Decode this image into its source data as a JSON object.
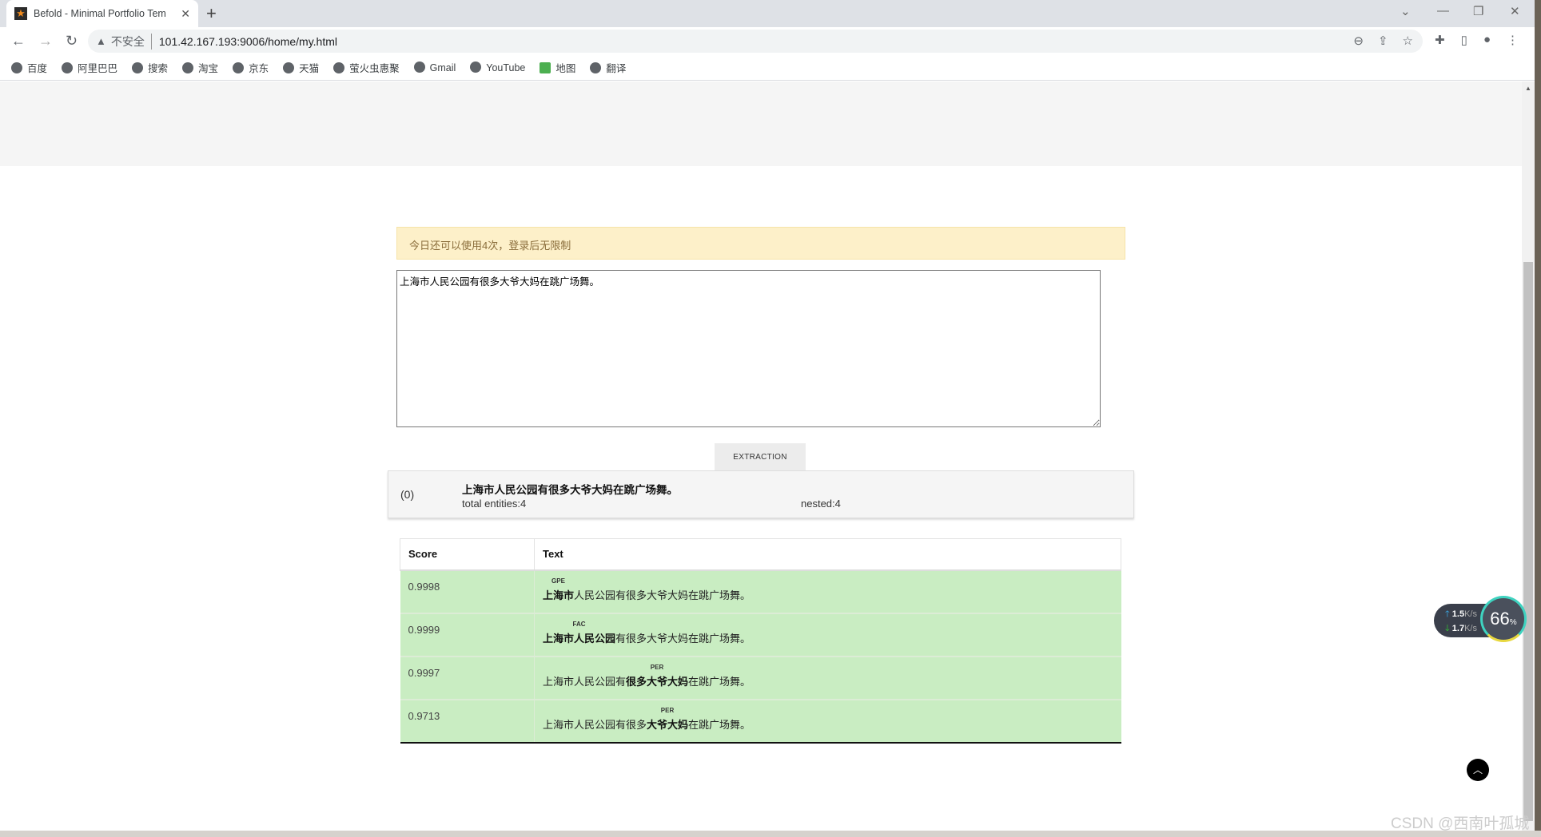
{
  "browser": {
    "tab_title": "Befold - Minimal Portfolio Tem",
    "security_label": "不安全",
    "url": "101.42.167.193:9006/home/my.html",
    "bookmarks": [
      "百度",
      "阿里巴巴",
      "搜索",
      "淘宝",
      "京东",
      "天猫",
      "萤火虫惠聚",
      "Gmail",
      "YouTube",
      "地图",
      "翻译"
    ]
  },
  "alert": "今日还可以使用4次，登录后无限制",
  "input_text": "上海市人民公园有很多大爷大妈在跳广场舞。",
  "extract_button": "EXTRACTION",
  "result": {
    "index": "(0)",
    "sentence": "上海市人民公园有很多大爷大妈在跳广场舞。",
    "total": "total entities:4",
    "nested": "nested:4"
  },
  "table": {
    "headers": [
      "Score",
      "Text"
    ],
    "rows": [
      {
        "score": "0.9998",
        "label": "GPE",
        "pre": "",
        "entity": "上海市",
        "post": "人民公园有很多大爷大妈在跳广场舞。"
      },
      {
        "score": "0.9999",
        "label": "FAC",
        "pre": "",
        "entity": "上海市人民公园",
        "post": "有很多大爷大妈在跳广场舞。"
      },
      {
        "score": "0.9997",
        "label": "PER",
        "pre": "上海市人民公园有",
        "entity": "很多大爷大妈",
        "post": "在跳广场舞。"
      },
      {
        "score": "0.9713",
        "label": "PER",
        "pre": "上海市人民公园有很多",
        "entity": "大爷大妈",
        "post": "在跳广场舞。"
      }
    ]
  },
  "widget": {
    "up": "1.5",
    "down": "1.7",
    "unit": "K/s",
    "percent": "66",
    "percent_sign": "%"
  },
  "watermark": "CSDN @西南叶孤城",
  "colors": {
    "row_bg": "#c9edc2",
    "alert_bg": "#fdf0c9"
  }
}
